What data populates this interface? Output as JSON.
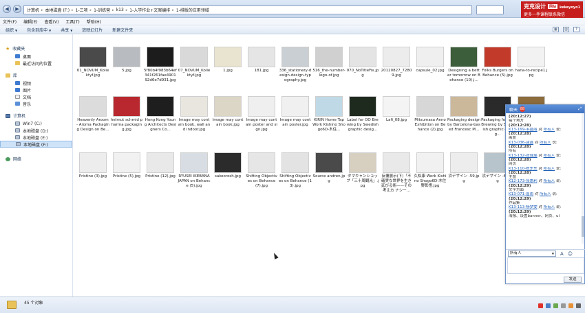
{
  "address": {
    "crumbs": [
      "计算机",
      "本地磁盘 (F:)",
      "1-三项",
      "1-训练营",
      "k13",
      "1-入学作业+文案编排",
      "1-排版的应用领域"
    ]
  },
  "brand": {
    "title": "克克设计",
    "tag": "网站",
    "id": "kekeyoyo1",
    "subtitle": "更多一手课程联系微信"
  },
  "menu": [
    "文件(F)",
    "编辑(E)",
    "查看(V)",
    "工具(T)",
    "帮助(H)"
  ],
  "toolbar": {
    "items": [
      "组织",
      "包含到库中",
      "共享",
      "放映幻灯片",
      "新建文件夹"
    ],
    "dropdown_flags": [
      true,
      true,
      true,
      false,
      false
    ]
  },
  "sidebar": {
    "favorites": {
      "label": "收藏夹",
      "items": [
        "桌面",
        "最近访问的位置"
      ]
    },
    "libraries": {
      "label": "库",
      "items": [
        "视频",
        "图片",
        "文档",
        "音乐"
      ]
    },
    "computer": {
      "label": "计算机",
      "items": [
        "Win7 (C:)",
        "本地磁盘 (D:)",
        "本地磁盘 (E:)",
        "本地磁盘 (F:)"
      ]
    },
    "network": {
      "label": "网络"
    },
    "selected": "本地磁盘 (F:)"
  },
  "files": [
    {
      "name": "01_NOVUM_Koliektyf.jpg",
      "color": "#4a4a4a"
    },
    {
      "name": "5.jpg",
      "color": "#b8bcc0"
    },
    {
      "name": "5f80b4f983b64ef341f261fae490192d6e7d931.jpg",
      "color": "#1c1c1c"
    },
    {
      "name": "07_NOVUM_Koliektyf.jpg",
      "color": "#d9d9d9"
    },
    {
      "name": "1.jpg",
      "color": "#e8e4d0"
    },
    {
      "name": "181.jpg",
      "color": "#e5e5e5"
    },
    {
      "name": "336_stationery-design-design-typography.jpg",
      "color": "#c9cfd3"
    },
    {
      "name": "516_the-number-logo-of.jpg",
      "color": "#d0d0d0"
    },
    {
      "name": "970_NoTitleFix.jpg",
      "color": "#e4e4e4"
    },
    {
      "name": "20120827_72809.jpg",
      "color": "#ececec"
    },
    {
      "name": "capsule_02.jpg",
      "color": "#efefef"
    },
    {
      "name": "Designing a better tomorrow on Behance (10).j...",
      "color": "#3d5e3a"
    },
    {
      "name": "Folks Burgers on Behance (5).jpg",
      "color": "#c23a2a"
    },
    {
      "name": "hana-to-recipe1.jpg",
      "color": "#f2f2f2"
    },
    {
      "name": "Heavenly Aroom - Aroma Packaging Design on Be...",
      "color": "#dcdcdc"
    },
    {
      "name": "helmut schmid pharma packaging.jpg",
      "color": "#b8282e"
    },
    {
      "name": "Hong Kong Young Architects Designers Co...",
      "color": "#1e1e1e"
    },
    {
      "name": "Image may contain book, wall and indoor.jpg",
      "color": "#e9e6df"
    },
    {
      "name": "Image may contain book.jpg",
      "color": "#dcd6c6"
    },
    {
      "name": "Image may contain poster and sign.jpg",
      "color": "#efefef"
    },
    {
      "name": "Image may contain poster.jpg",
      "color": "#f0f0f0"
    },
    {
      "name": "KIRIN Home Tap Work Kishino Shogo6D-木住...",
      "color": "#bfd9e6"
    },
    {
      "name": "Label for OO Brewing by Swedish graphic desig...",
      "color": "#1f2a1f"
    },
    {
      "name": "Lafi_08.jpg",
      "color": "#f4f4f4"
    },
    {
      "name": "Mitsumasa Anno Exhibition on Behance (2).jpg",
      "color": "#d7d7d7"
    },
    {
      "name": "Packaging design by Barcelona-based Francesc M...",
      "color": "#cbb79a"
    },
    {
      "name": "Packaging for OO Brewing by Swedish graphic desig...",
      "color": "#2a2a2a"
    },
    {
      "name": "Photo by hosoyam... design on May 18",
      "color": "#8c6c3d"
    },
    {
      "name": "Pristine (3).jpg",
      "color": "#ededed"
    },
    {
      "name": "Pristine (5).jpg",
      "color": "#f1f1f1"
    },
    {
      "name": "Pristine (12).jpg",
      "color": "#e9e9e9"
    },
    {
      "name": "RYUSEI IKEBANA JAPAN on Behance (5).jpg",
      "color": "#d8dde4"
    },
    {
      "name": "sakeorosh.jpg",
      "color": "#2b2b2b"
    },
    {
      "name": "Shifting Objectives on Behance (7).jpg",
      "color": "#e6e6e6"
    },
    {
      "name": "Shifting Objectives on Behance (13).jpg",
      "color": "#e3e3e3"
    },
    {
      "name": "Source andren.jpg",
      "color": "#4a4a4a"
    },
    {
      "name": "タマキャンショップ「三十周観光」.jpg",
      "color": "#d7cfc0"
    },
    {
      "name": "反覆展示(下)「不確実な世界を生き延びる術——その考え方 ナシー...",
      "color": "#e9e9e9"
    },
    {
      "name": "久松康 Work Kishino Shogo6D-木住野彰悟.jpg",
      "color": "#f1f1f1"
    },
    {
      "name": "浜デザイン -59.jpg",
      "color": "#ededed"
    },
    {
      "name": "浜デザイン -64.jpg",
      "color": "#b7c4cc"
    }
  ],
  "status": {
    "count": "45 个对象"
  },
  "chat": {
    "title": "聊天",
    "badge": "88",
    "messages": [
      {
        "type": "time",
        "text": "(20:12:27)"
      },
      {
        "type": "text",
        "text": "每个地方"
      },
      {
        "type": "time",
        "text": "(20:12:28)"
      },
      {
        "type": "sender",
        "name": "K13-169-韦嘉丽",
        "to": "所有人",
        "suffix": "说:"
      },
      {
        "type": "time",
        "text": "(20:12:28)"
      },
      {
        "type": "text",
        "text": "画册"
      },
      {
        "type": "sender",
        "name": "K13-036-龚鑫",
        "to": "所有人",
        "suffix": "说:"
      },
      {
        "type": "time",
        "text": "(20:12:28)"
      },
      {
        "type": "text",
        "text": "所有"
      },
      {
        "type": "sender",
        "name": "K13-132-张瑶瑶",
        "to": "所有人",
        "suffix": "说:"
      },
      {
        "type": "time",
        "text": "(20:12:28)"
      },
      {
        "type": "text",
        "text": "网页"
      },
      {
        "type": "sender",
        "name": "K13-110-陈东东",
        "to": "所有人",
        "suffix": "说:"
      },
      {
        "type": "time",
        "text": "(20:12:28)"
      },
      {
        "type": "text",
        "text": "主图"
      },
      {
        "type": "sender",
        "name": "K12-173-张惠利",
        "to": "所有人",
        "suffix": "说:"
      },
      {
        "type": "time",
        "text": "(20:12:29)"
      },
      {
        "type": "text",
        "text": "文字方面"
      },
      {
        "type": "sender",
        "name": "K13-071-曾雨",
        "to": "所有人",
        "suffix": "说:"
      },
      {
        "type": "time",
        "text": "(20:12:29)"
      },
      {
        "type": "text",
        "text": "作品集"
      },
      {
        "type": "sender",
        "name": "K13-113-杨梦雯",
        "to": "所有人",
        "suffix": "说:"
      },
      {
        "type": "time",
        "text": "(20:12:29)"
      },
      {
        "type": "text",
        "text": "海报、设置banner、网页、ui"
      }
    ],
    "recipient": "所有人",
    "send_label": "发送"
  }
}
